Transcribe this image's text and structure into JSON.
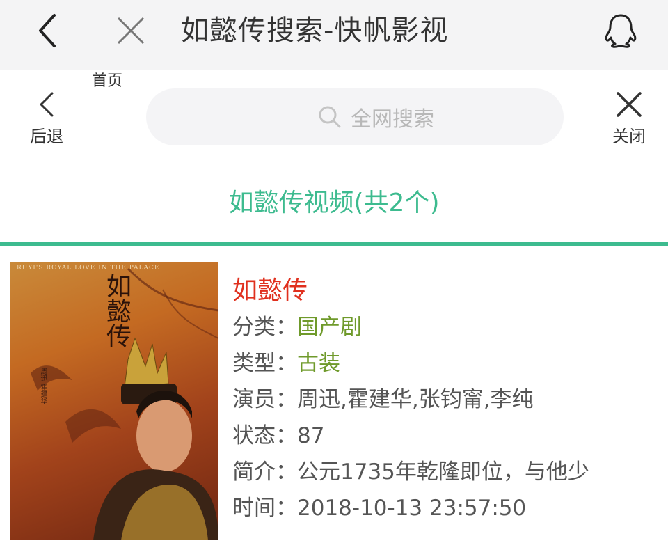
{
  "titlebar": {
    "title": "如懿传搜索-快帆影视",
    "back_icon": "chevron-left-icon",
    "close_icon": "close-icon",
    "qq_icon": "qq-penguin-icon"
  },
  "nav": {
    "homepage_label": "首页",
    "back_label": "后退",
    "close_label": "关闭",
    "search_placeholder": "全网搜索"
  },
  "section": {
    "title": "如懿传视频(共2个)",
    "accent_color": "#3dbb8f"
  },
  "result": {
    "poster": {
      "title_text": "如懿传",
      "tagline": "RUYI'S ROYAL LOVE IN THE PALACE",
      "cast_text": "周迅 霍建华"
    },
    "name": "如懿传",
    "name_color": "#e0301e",
    "fields": [
      {
        "label": "分类：",
        "value": "国产剧",
        "is_link": true
      },
      {
        "label": "类型：",
        "value": "古装",
        "is_link": true
      },
      {
        "label": "演员：",
        "value": "周迅,霍建华,张钧甯,李纯",
        "is_link": false
      },
      {
        "label": "状态：",
        "value": "87",
        "is_link": false
      },
      {
        "label": "简介：",
        "value": "公元1735年乾隆即位，与他少",
        "is_link": false
      },
      {
        "label": "时间：",
        "value": "2018-10-13 23:57:50",
        "is_link": false
      }
    ]
  }
}
